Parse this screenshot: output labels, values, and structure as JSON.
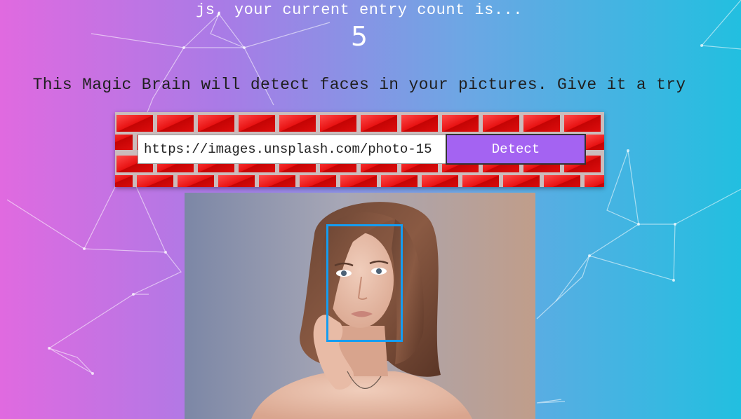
{
  "header": {
    "rank_line": "js, your current entry count is...",
    "entry_count": "5"
  },
  "intro_text": "This Magic Brain will detect faces in your pictures. Give it a try",
  "image_form": {
    "url_value": "https://images.unsplash.com/photo-15",
    "detect_label": "Detect"
  },
  "result_image": {
    "subject": "portrait photo of a woman with shoulder-length brown hair",
    "face_box_color": "#149df2"
  },
  "colors": {
    "bg_left": "#e06ae0",
    "bg_right": "#22bfe0",
    "button": "#a463f2",
    "brick": "#e20e0e"
  }
}
